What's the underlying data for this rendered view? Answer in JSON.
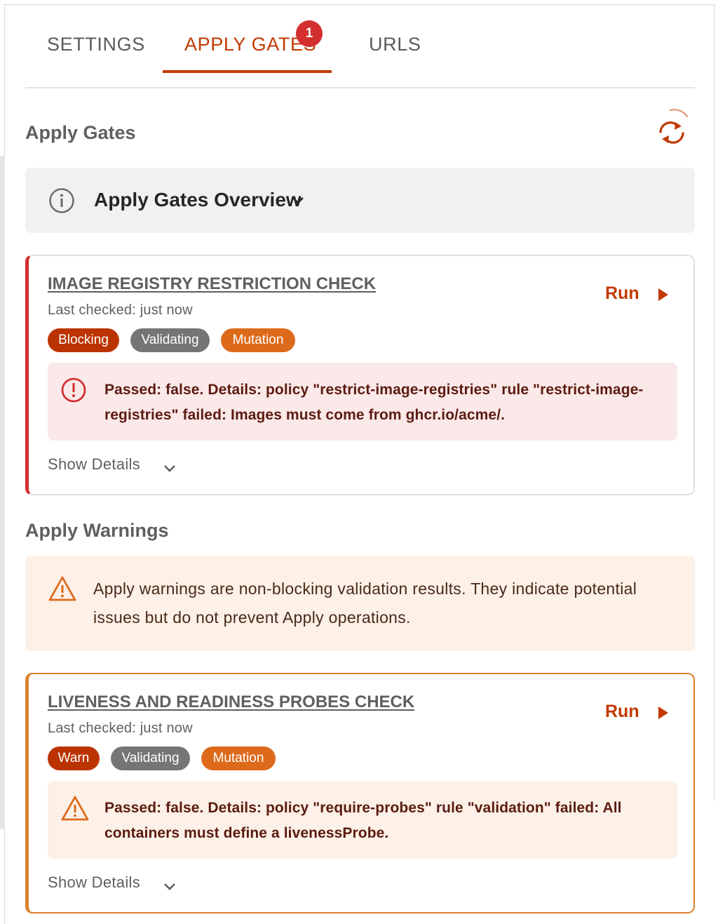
{
  "tabs": {
    "settings": "SETTINGS",
    "apply_gates": "APPLY GATES",
    "apply_gates_badge": "1",
    "urls": "URLS",
    "active": "apply_gates"
  },
  "apply_gates": {
    "title": "Apply Gates",
    "overview_label": "Apply Gates Overview"
  },
  "gate_card": {
    "title": "IMAGE REGISTRY RESTRICTION CHECK",
    "last_checked": "Last checked: just now",
    "run_label": "Run",
    "chips": [
      "Blocking",
      "Validating",
      "Mutation"
    ],
    "message": "Passed: false. Details: policy \"restrict-image-registries\" rule \"restrict-image-registries\" failed: Images must come from ghcr.io/acme/.",
    "show_details": "Show Details",
    "accent": "#d32f2f"
  },
  "apply_warnings": {
    "title": "Apply Warnings",
    "banner_text": "Apply warnings are non-blocking validation results. They indicate potential issues but do not prevent Apply operations."
  },
  "warning_card": {
    "title": "LIVENESS AND READINESS PROBES CHECK",
    "last_checked": "Last checked: just now",
    "run_label": "Run",
    "chips": [
      "Warn",
      "Validating",
      "Mutation"
    ],
    "message": "Passed: false. Details: policy \"require-probes\" rule \"validation\" failed: All containers must define a livenessProbe.",
    "show_details": "Show Details",
    "accent": "#d9822b"
  },
  "colors": {
    "brand": "#c23a00",
    "error": "#d32f2f",
    "warning": "#d9822b",
    "chip_blocking": "#bb3300",
    "chip_validating": "#757575",
    "chip_mutation": "#dd6a1b"
  },
  "icons": {
    "refresh": "refresh-icon",
    "info": "info-icon",
    "error": "error-circle-icon",
    "warning": "warning-triangle-icon",
    "run": "play-icon",
    "expand": "chevron-down-icon"
  }
}
